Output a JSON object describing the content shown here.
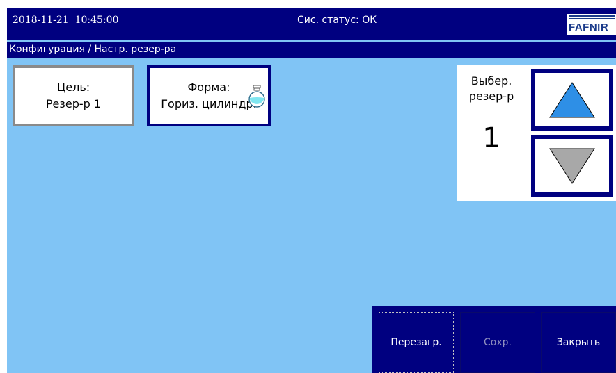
{
  "header": {
    "datetime": "2018-11-21  10:45:00",
    "status": "Сис. статус: ОК",
    "logo_text": "FAFNIR"
  },
  "breadcrumb": "Конфигурация / Настр. резер-ра",
  "target_button": {
    "line1": "Цель:",
    "line2": "Резер-р 1"
  },
  "shape_button": {
    "line1": "Форма:",
    "line2": "Гориз. цилиндр.",
    "icon": "tank-icon"
  },
  "selector": {
    "label_line1": "Выбер.",
    "label_line2": "резер-р",
    "value": "1",
    "up_icon": "triangle-up-icon",
    "down_icon": "triangle-down-icon"
  },
  "actions": {
    "reload": "Перезагр.",
    "save": "Сохр.",
    "close": "Закрыть"
  },
  "colors": {
    "screen_bg": "#80c4f5",
    "bar_bg": "#000080",
    "up_arrow": "#2e8fe6",
    "down_arrow": "#a8a8a8",
    "disabled_text": "#8e8ebe"
  }
}
